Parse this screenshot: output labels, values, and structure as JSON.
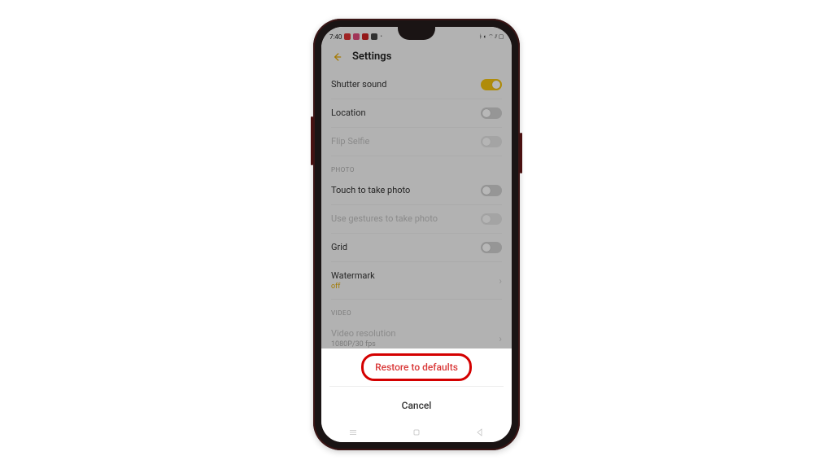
{
  "status": {
    "time": "7:40"
  },
  "header": {
    "title": "Settings"
  },
  "general": {
    "shutter_sound": "Shutter sound",
    "location": "Location",
    "flip_selfie": "Flip Selfie"
  },
  "photo_section": "PHOTO",
  "photo": {
    "touch_take": "Touch to take photo",
    "gestures": "Use gestures to take photo",
    "grid": "Grid",
    "watermark": "Watermark",
    "watermark_value": "off"
  },
  "video_section": "VIDEO",
  "video": {
    "resolution": "Video resolution",
    "resolution_value": "1080P/30 fps"
  },
  "sheet": {
    "restore": "Restore to defaults",
    "cancel": "Cancel"
  }
}
